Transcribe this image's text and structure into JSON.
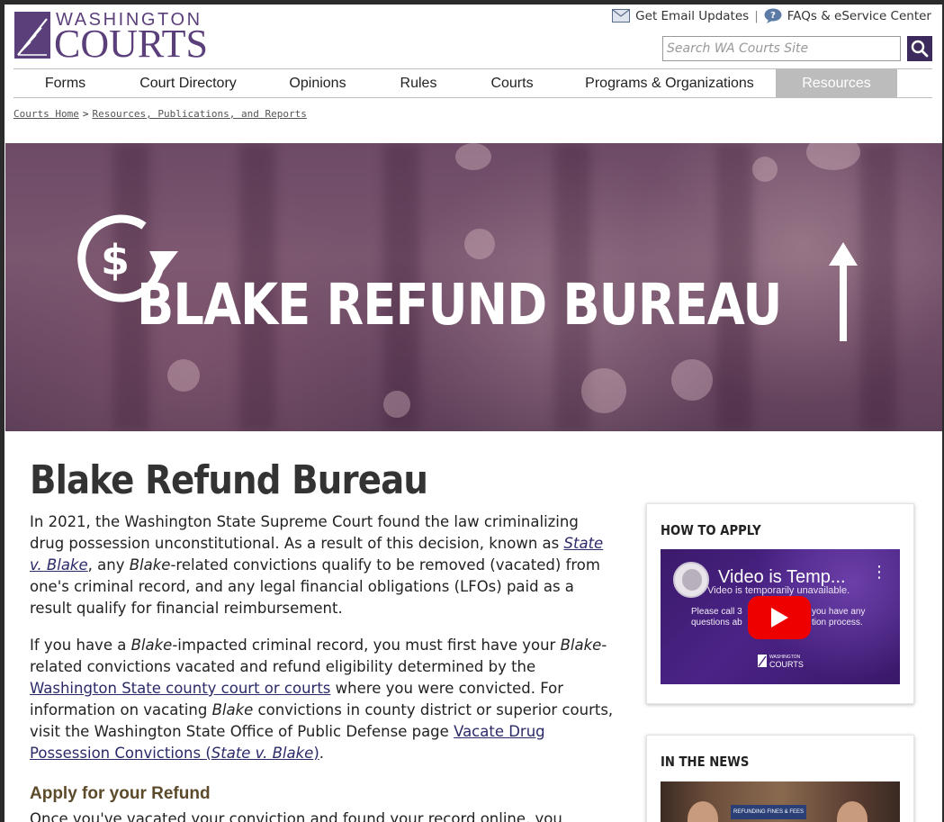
{
  "header": {
    "logo_top": "WASHINGTON",
    "logo_bottom": "COURTS",
    "email_label": "Get Email Updates",
    "separator": "|",
    "faq_label": "FAQs & eService Center",
    "search_placeholder": "Search WA Courts Site"
  },
  "nav": {
    "items": [
      {
        "label": "Forms"
      },
      {
        "label": "Court Directory"
      },
      {
        "label": "Opinions"
      },
      {
        "label": "Rules"
      },
      {
        "label": "Courts"
      },
      {
        "label": "Programs & Organizations"
      },
      {
        "label": "Resources"
      }
    ],
    "active": "Resources"
  },
  "breadcrumb": {
    "home": "Courts Home",
    "gt": ">",
    "current": "Resources, Publications, and Reports"
  },
  "hero": {
    "title": "BLAKE REFUND BUREAU"
  },
  "main": {
    "title": "Blake Refund Bureau",
    "p1": {
      "a": "In 2021, the Washington State Supreme Court found the law criminalizing drug possession unconstitutional. As a result of this decision, known as ",
      "link": "State v. Blake",
      "b": ", any ",
      "em": "Blake",
      "c": "-related convictions qualify to be removed (vacated) from one's criminal record, and any legal financial obligations (LFOs) paid as a result qualify for financial reimbursement."
    },
    "p2": {
      "a": "If you have a ",
      "em1": "Blake",
      "b": "-impacted criminal record, you must first have your ",
      "em2": "Blake",
      "c": "-related convictions vacated and refund eligibility determined by the ",
      "link1": "Washington State county court or courts",
      "d": " where you were convicted. For information on vacating ",
      "em3": "Blake",
      "e": " convictions in county district or superior courts, visit the Washington State Office of Public Defense page ",
      "link2a": "Vacate Drug Possession Convictions (",
      "link2em": "State v. Blake",
      "link2b": ")",
      "f": "."
    },
    "section_heading": "Apply for your Refund",
    "p3": "Once you've vacated your conviction and found your record online, you"
  },
  "sidebar": {
    "how_to_apply": {
      "title": "HOW TO APPLY",
      "video_title": "Video is Temp...",
      "video_sub": "Video is temporarily unavailable.",
      "video_text_left": "Please call 3\nquestions ab",
      "video_text_right": "you have any\ntion process.",
      "video_logo": "COURTS",
      "video_logo_top": "WASHINGTON"
    },
    "news": {
      "title": "IN THE NEWS",
      "thumb_banner": "REFUNDING FINES & FEES"
    }
  },
  "colors": {
    "brand_purple": "#5a3f7a",
    "search_button": "#3d2a5c",
    "nav_active_bg": "#bcbcbc",
    "section_heading": "#5c4a2a",
    "link": "#2b2a68",
    "play_button": "#ee0000"
  }
}
